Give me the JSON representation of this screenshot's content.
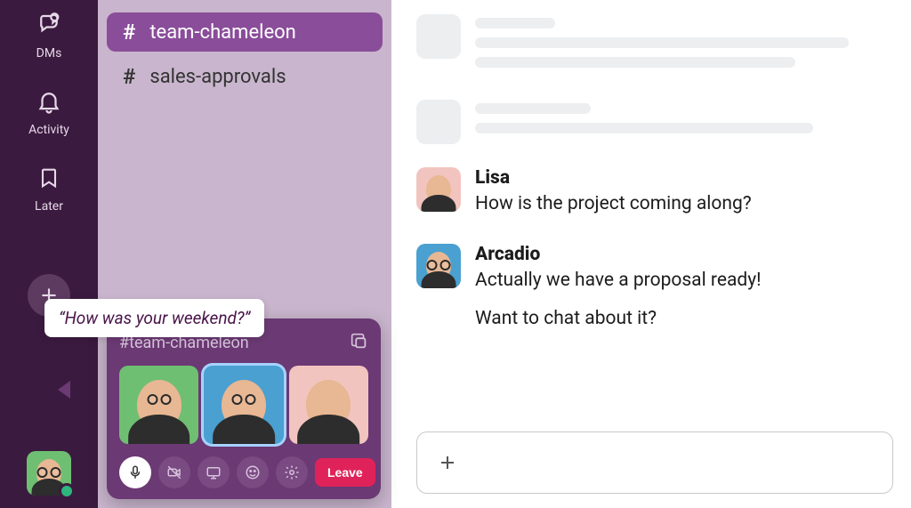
{
  "rail": {
    "dms_label": "DMs",
    "activity_label": "Activity",
    "later_label": "Later"
  },
  "channels": [
    {
      "name": "team-chameleon",
      "active": true
    },
    {
      "name": "sales-approvals",
      "active": false
    }
  ],
  "huddle": {
    "title": "#team-chameleon",
    "speech": "“How was your weekend?”",
    "leave_label": "Leave"
  },
  "messages": [
    {
      "author": "Lisa",
      "lines": [
        "How is the project coming along?"
      ]
    },
    {
      "author": "Arcadio",
      "lines": [
        "Actually we have a proposal ready!",
        "Want to chat about it?"
      ]
    }
  ],
  "colors": {
    "rail_bg": "#3b1a3f",
    "channel_bg": "#c9b5cd",
    "channel_active": "#8a4d9a",
    "huddle_bg": "#6b3973",
    "leave_btn": "#e0225a"
  }
}
